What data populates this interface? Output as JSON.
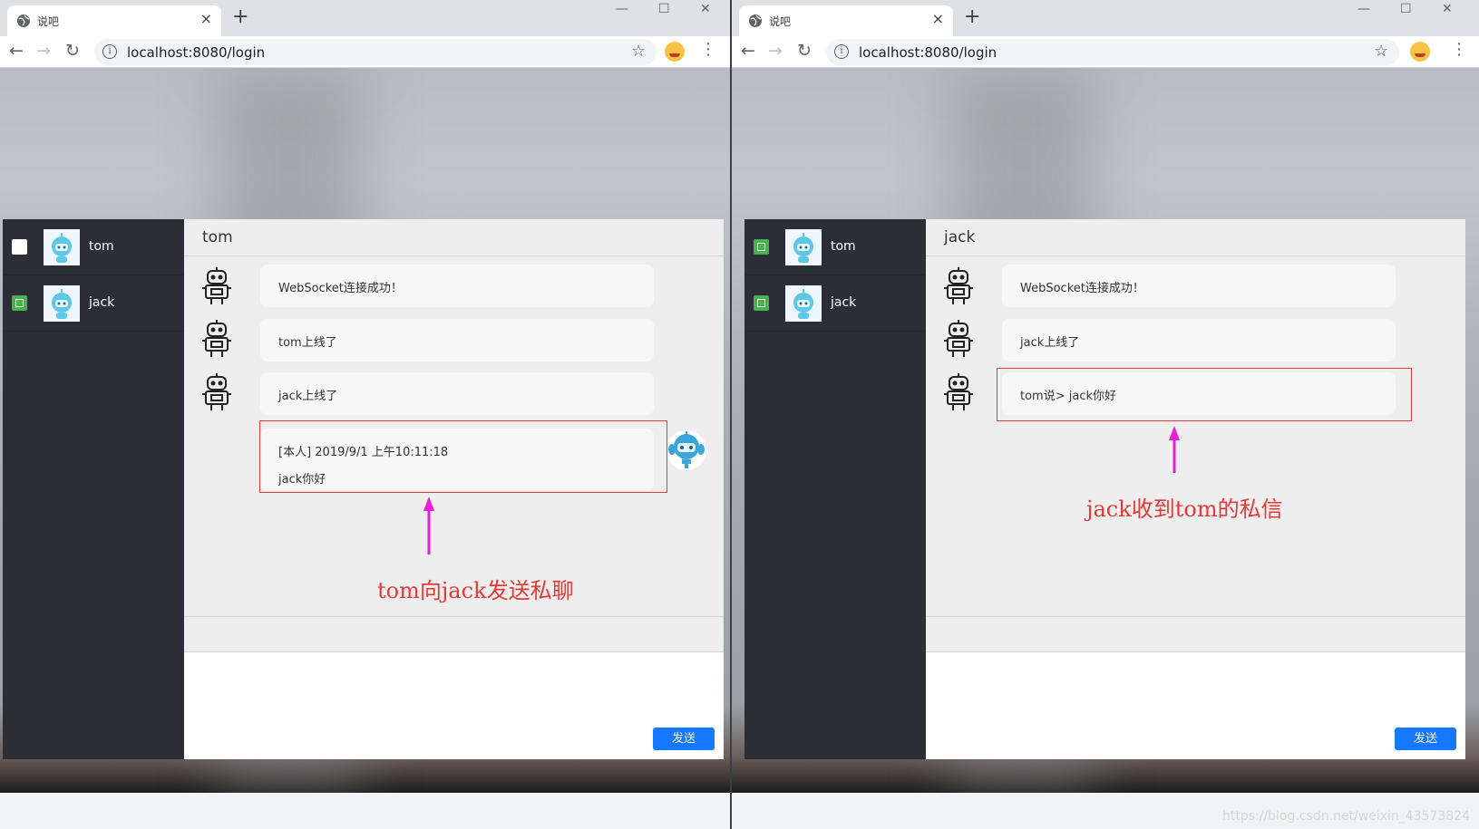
{
  "colors": {
    "accent": "#1677ff",
    "online": "#4caf50",
    "sidebar": "#2b2e35",
    "annotation": "#e53935",
    "arrow": "#e91ed6"
  },
  "windows": [
    {
      "tab_title": "说吧",
      "url": "localhost:8080/login",
      "users": [
        {
          "name": "tom",
          "status": "white"
        },
        {
          "name": "jack",
          "status": "green"
        }
      ],
      "chat_title": "tom",
      "messages": [
        {
          "lines": [
            "WebSocket连接成功！"
          ]
        },
        {
          "lines": [
            "tom上线了"
          ]
        },
        {
          "lines": [
            "jack上线了"
          ]
        },
        {
          "lines": [
            "[本人] 2019/9/1 上午10:11:18",
            "jack你好"
          ]
        }
      ],
      "send_label": "发送",
      "annotation": "tom向jack发送私聊"
    },
    {
      "tab_title": "说吧",
      "url": "localhost:8080/login",
      "users": [
        {
          "name": "tom",
          "status": "green"
        },
        {
          "name": "jack",
          "status": "green"
        }
      ],
      "chat_title": "jack",
      "messages": [
        {
          "lines": [
            "WebSocket连接成功！"
          ]
        },
        {
          "lines": [
            "jack上线了"
          ]
        },
        {
          "lines": [
            "tom说> jack你好"
          ]
        }
      ],
      "send_label": "发送",
      "annotation": "jack收到tom的私信"
    }
  ],
  "watermark": "https://blog.csdn.net/weixin_43573824"
}
